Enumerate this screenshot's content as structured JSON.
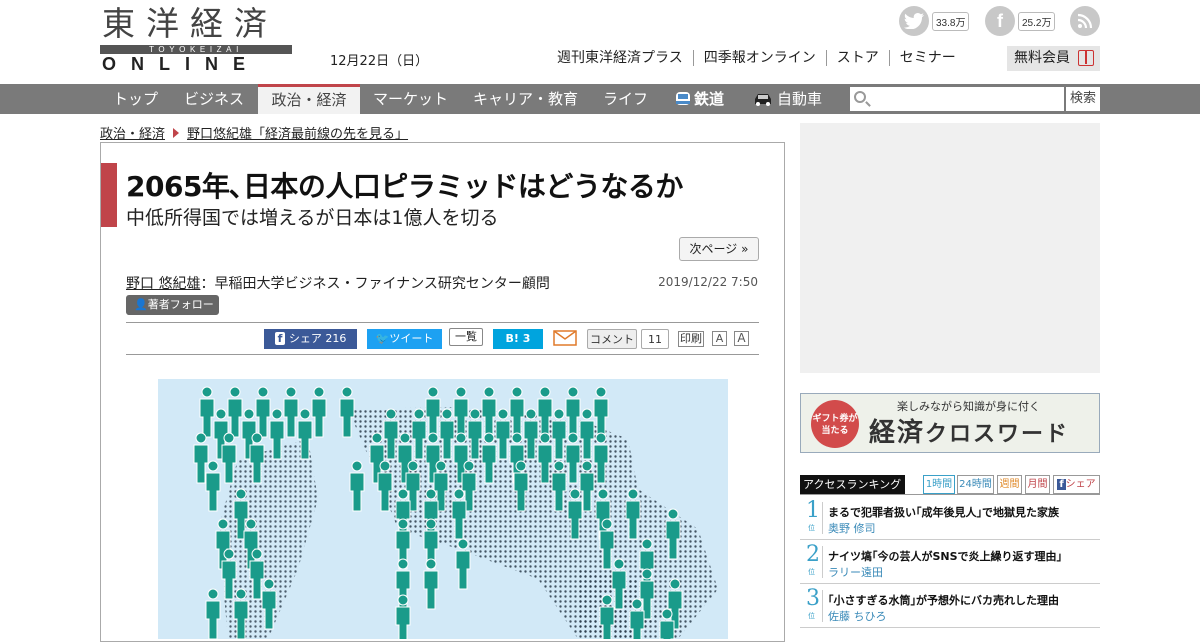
{
  "header": {
    "logo_kanji": "東洋経済",
    "logo_romaji": "TOYOKEIZAI",
    "logo_online": "ONLINE",
    "date": "12月22日（日）",
    "twitter_count": "33.8万",
    "facebook_count": "25.2万",
    "links": [
      "週刊東洋経済プラス",
      "四季報オンライン",
      "ストア",
      "セミナー"
    ],
    "member_label": "無料会員"
  },
  "nav": {
    "items": [
      "トップ",
      "ビジネス",
      "政治・経済",
      "マーケット",
      "キャリア・教育",
      "ライフ",
      "鉄道",
      "自動車"
    ],
    "search_placeholder": "",
    "search_button": "検索"
  },
  "breadcrumb": {
    "category": "政治・経済",
    "series": "野口悠紀雄「経済最前線の先を見る」"
  },
  "article": {
    "title": "2065年､日本の人口ピラミッドはどうなるか",
    "subtitle": "中低所得国では増えるが日本は1億人を切る",
    "next_page": "次ページ »",
    "author_name": "野口 悠紀雄",
    "author_affiliation": "：早稲田大学ビジネス・ファイナンス研究センター顧問",
    "published": "2019/12/22 7:50",
    "follow_label": "著者フォロー"
  },
  "share": {
    "facebook_label": "シェア",
    "facebook_count": "216",
    "tweet_label": "ツイート",
    "list_label": "一覧",
    "hatena_label": "B!",
    "hatena_count": "3",
    "comment_label": "コメント",
    "comment_count": "11",
    "print_label": "印刷",
    "font_small": "A",
    "font_large": "A"
  },
  "banner": {
    "badge": "ギフト券が当たる",
    "tagline": "楽しみながら知識が身に付く",
    "title_a": "経済",
    "title_b": "クロスワード"
  },
  "ranking": {
    "title": "アクセスランキング",
    "tabs": [
      "1時間",
      "24時間",
      "週間",
      "月間",
      "シェア"
    ],
    "position_label": "位",
    "items": [
      {
        "rank": "1",
        "title": "まるで犯罪者扱い｢成年後見人｣で地獄見た家族",
        "author": "奥野 修司"
      },
      {
        "rank": "2",
        "title": "ナイツ塙｢今の芸人がSNSで炎上繰り返す理由｣",
        "author": "ラリー遠田"
      },
      {
        "rank": "3",
        "title": "｢小さすぎる水筒｣が予想外にバカ売れした理由",
        "author": "佐藤 ちひろ"
      }
    ]
  },
  "colors": {
    "accent_red": "#c0444a",
    "nav_gray": "#7a7a7a",
    "facebook_blue": "#3b5998",
    "twitter_blue": "#1da1f2",
    "hatena_blue": "#00a4de",
    "rank_blue": "#3aa0c8",
    "figure_teal": "#1a9b8a",
    "map_blue": "#d2e9f7"
  }
}
